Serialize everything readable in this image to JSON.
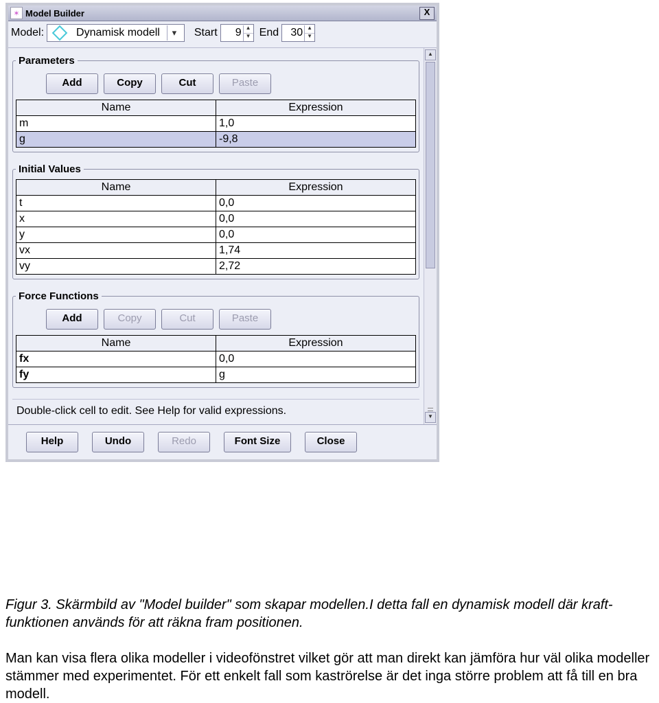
{
  "window": {
    "title": "Model Builder"
  },
  "toolbar": {
    "model_label": "Model:",
    "model_name": "Dynamisk modell",
    "start_label": "Start",
    "start_value": "9",
    "end_label": "End",
    "end_value": "30"
  },
  "parameters": {
    "legend": "Parameters",
    "buttons": {
      "add": "Add",
      "copy": "Copy",
      "cut": "Cut",
      "paste": "Paste"
    },
    "headers": {
      "name": "Name",
      "expr": "Expression"
    },
    "rows": [
      {
        "name": "m",
        "expr": "1,0"
      },
      {
        "name": "g",
        "expr": "-9,8"
      }
    ]
  },
  "initial": {
    "legend": "Initial Values",
    "headers": {
      "name": "Name",
      "expr": "Expression"
    },
    "rows": [
      {
        "name": "t",
        "expr": "0,0"
      },
      {
        "name": "x",
        "expr": "0,0"
      },
      {
        "name": "y",
        "expr": "0,0"
      },
      {
        "name": "vx",
        "expr": "1,74"
      },
      {
        "name": "vy",
        "expr": "2,72"
      }
    ]
  },
  "force": {
    "legend": "Force Functions",
    "buttons": {
      "add": "Add",
      "copy": "Copy",
      "cut": "Cut",
      "paste": "Paste"
    },
    "headers": {
      "name": "Name",
      "expr": "Expression"
    },
    "rows": [
      {
        "name": "fx",
        "expr": "0,0"
      },
      {
        "name": "fy",
        "expr": "g"
      }
    ]
  },
  "help_text": "Double-click cell to edit. See Help for valid expressions.",
  "footer": {
    "help": "Help",
    "undo": "Undo",
    "redo": "Redo",
    "font": "Font Size",
    "close": "Close"
  },
  "caption": {
    "line1a": "Figur 3. Skärmbild av \"Model builder\" som skapar modellen.",
    "line1b": "I detta fall en dynamisk modell där kraft-funktionen används för att räkna fram positionen.",
    "para2": "Man kan visa flera olika modeller i videofönstret vilket gör att man direkt kan jämföra hur väl olika modeller stämmer med experimentet. För ett enkelt fall som kaströrelse är det inga större problem att få till en bra modell."
  }
}
